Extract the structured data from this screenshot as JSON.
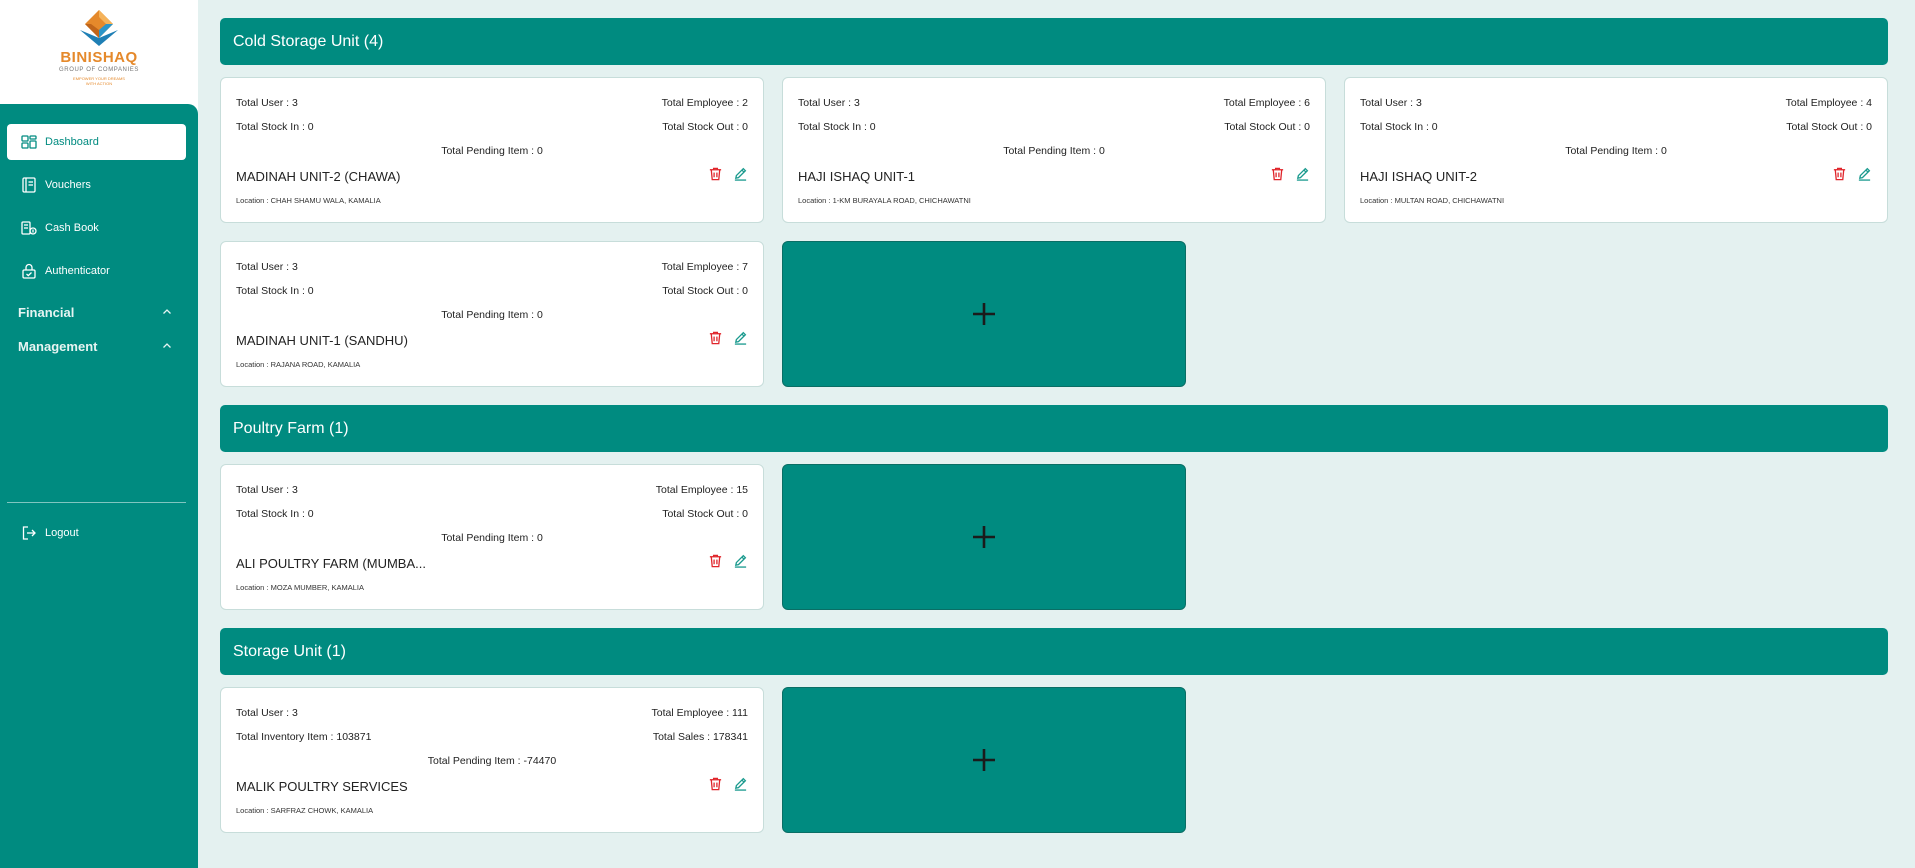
{
  "brand": {
    "name": "BINISHAQ",
    "sub": "GROUP OF COMPANIES",
    "tagline": "EMPOWER YOUR DREAMS WITH ACTION"
  },
  "nav": {
    "items": [
      {
        "label": "Dashboard",
        "icon": "dashboard-icon",
        "active": true
      },
      {
        "label": "Vouchers",
        "icon": "notebook-icon"
      },
      {
        "label": "Cash Book",
        "icon": "cash-icon"
      },
      {
        "label": "Authenticator",
        "icon": "lock-icon"
      }
    ],
    "groups": [
      {
        "label": "Financial",
        "icon": "chevron-up-icon"
      },
      {
        "label": "Management",
        "icon": "chevron-up-icon"
      }
    ],
    "logout": "Logout"
  },
  "colors": {
    "accent": "#008b80",
    "background": "#e4f1f0",
    "danger": "#e0252b",
    "edit": "#1a9a8e"
  },
  "sections": [
    {
      "title": "Cold Storage Unit (4)",
      "cards": [
        {
          "total_user": "Total User : 3",
          "total_employee": "Total Employee : 2",
          "stock_in": "Total Stock In : 0",
          "stock_out": "Total Stock Out : 0",
          "pending": "Total Pending Item : 0",
          "name": "MADINAH UNIT-2 (CHAWA)",
          "location": "Location : CHAH SHAMU WALA, KAMALIA"
        },
        {
          "total_user": "Total User : 3",
          "total_employee": "Total Employee : 6",
          "stock_in": "Total Stock In : 0",
          "stock_out": "Total Stock Out : 0",
          "pending": "Total Pending Item : 0",
          "name": "HAJI ISHAQ UNIT-1",
          "location": "Location : 1-KM BURAYALA ROAD, CHICHAWATNI"
        },
        {
          "total_user": "Total User : 3",
          "total_employee": "Total Employee : 4",
          "stock_in": "Total Stock In : 0",
          "stock_out": "Total Stock Out : 0",
          "pending": "Total Pending Item : 0",
          "name": "HAJI ISHAQ UNIT-2",
          "location": "Location : MULTAN ROAD, CHICHAWATNI"
        },
        {
          "total_user": "Total User : 3",
          "total_employee": "Total Employee : 7",
          "stock_in": "Total Stock In : 0",
          "stock_out": "Total Stock Out : 0",
          "pending": "Total Pending Item : 0",
          "name": "MADINAH UNIT-1 (SANDHU)",
          "location": "Location : RAJANA ROAD, KAMALIA"
        }
      ]
    },
    {
      "title": "Poultry Farm (1)",
      "cards": [
        {
          "total_user": "Total User : 3",
          "total_employee": "Total Employee : 15",
          "stock_in": "Total Stock In : 0",
          "stock_out": "Total Stock Out : 0",
          "pending": "Total Pending Item : 0",
          "name": "ALI POULTRY FARM (MUMBA...",
          "location": "Location : MOZA MUMBER, KAMALIA"
        }
      ]
    },
    {
      "title": "Storage Unit (1)",
      "cards": [
        {
          "total_user": "Total User : 3",
          "total_employee": "Total Employee : 111",
          "stock_in": "Total Inventory Item : 103871",
          "stock_out": "Total Sales : 178341",
          "pending": "Total Pending Item : -74470",
          "name": "MALIK POULTRY SERVICES",
          "location": "Location : SARFRAZ CHOWK, KAMALIA"
        }
      ]
    }
  ]
}
